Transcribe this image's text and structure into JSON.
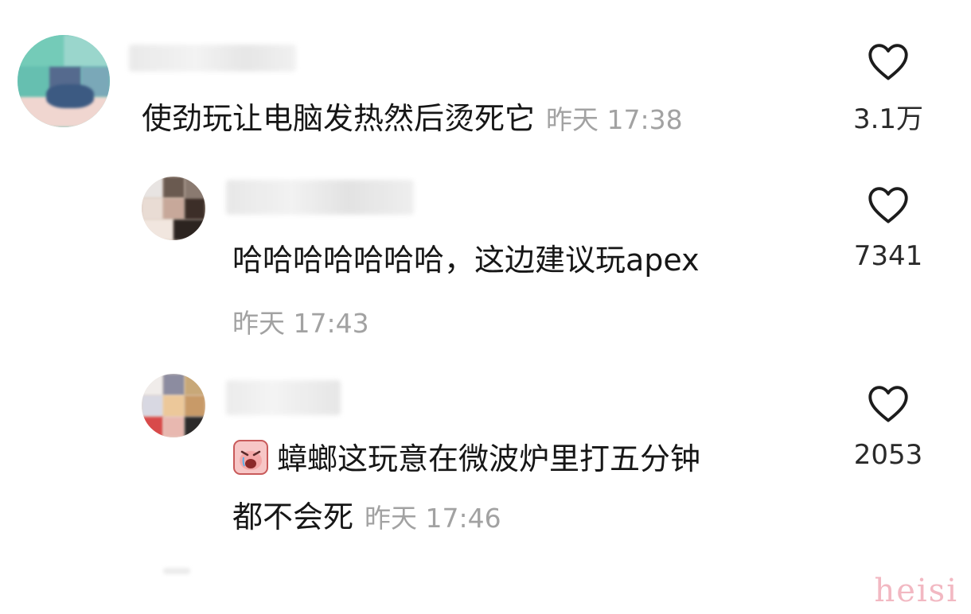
{
  "comments": [
    {
      "text": "使劲玩让电脑发热然后烫死它",
      "time": "昨天 17:38",
      "likes": "3.1万"
    },
    {
      "text": "哈哈哈哈哈哈哈，这边建议玩apex",
      "time": "昨天 17:43",
      "likes": "7341"
    },
    {
      "emoji": "crying-face-sticker",
      "text_line1": "蟑螂这玩意在微波炉里打五分钟",
      "text_line2": "都不会死",
      "time": "昨天 17:46",
      "likes": "2053"
    }
  ],
  "icons": {
    "like": "heart-outline-icon"
  },
  "watermark": "heisi",
  "colors": {
    "text": "#161616",
    "timestamp": "#a2a2a2",
    "watermark": "#f2b8c2"
  }
}
